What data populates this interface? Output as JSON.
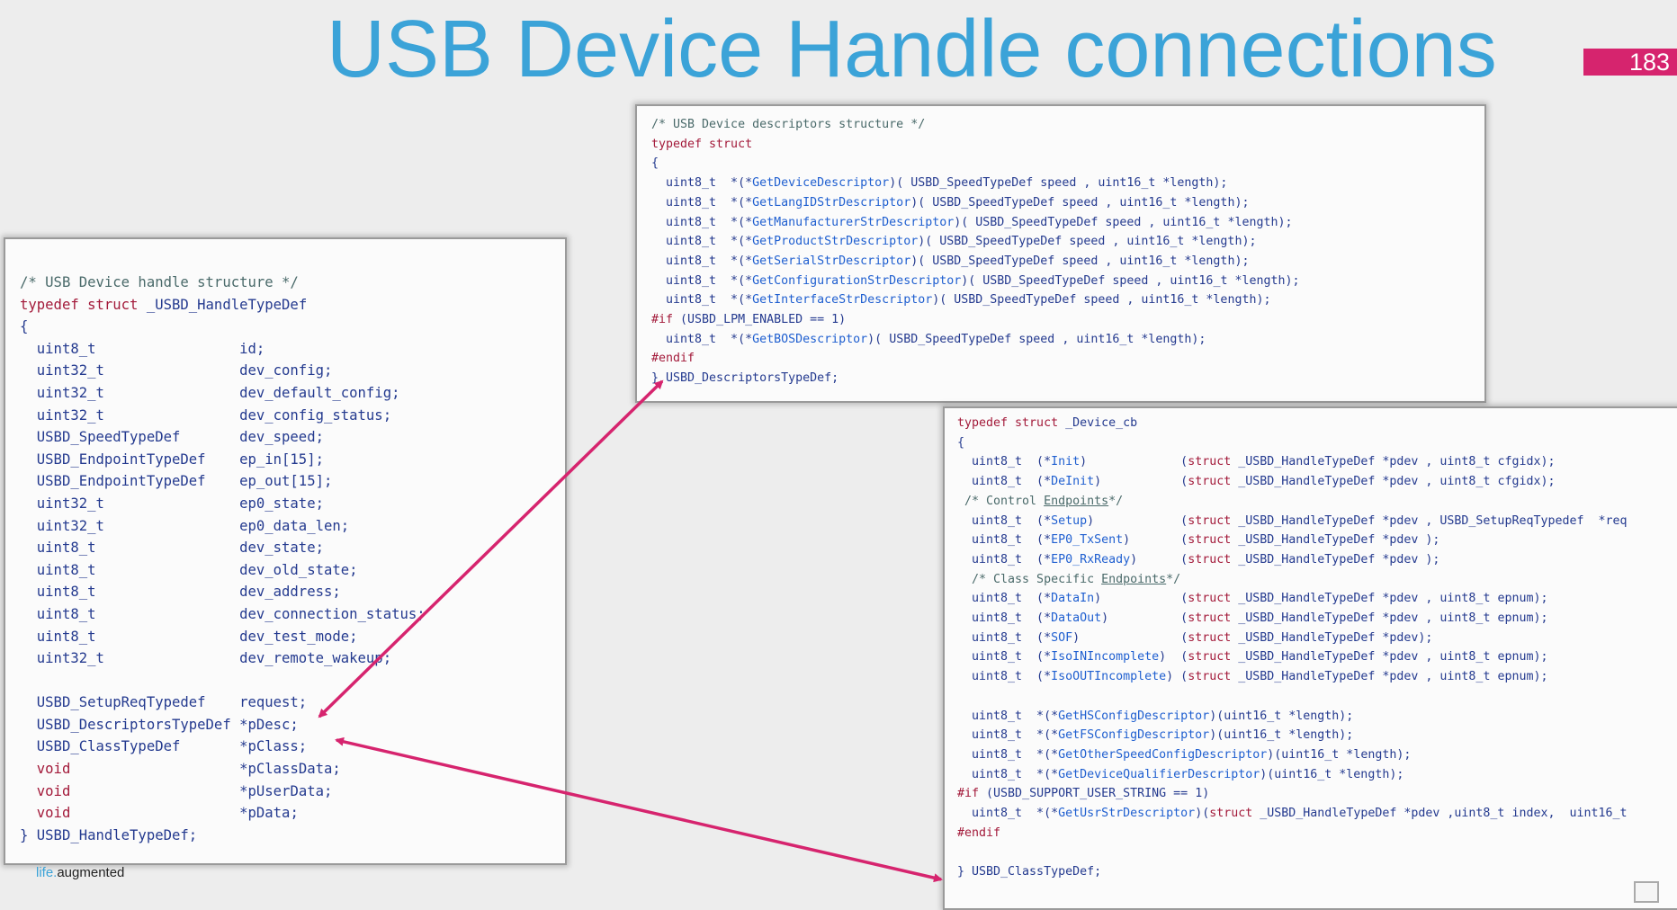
{
  "slide": {
    "title": "USB Device Handle connections",
    "page_number": "183",
    "footer": {
      "brand_life": "life.",
      "brand_rest": "augmented"
    }
  },
  "colors": {
    "title": "#3ba3d8",
    "badge": "#d6246e",
    "arrow": "#d6246e",
    "keyword": "#a31a3a",
    "function": "#1f5fd0",
    "code": "#243a8f",
    "comment": "#4a6a6a"
  },
  "handle_panel": {
    "lines": [
      [
        {
          "t": "/* USB Device handle structure */",
          "c": "cm"
        }
      ],
      [
        {
          "t": "typedef struct",
          "c": "kw"
        },
        {
          "t": " _USBD_HandleTypeDef"
        }
      ],
      [
        {
          "t": "{"
        }
      ],
      [
        {
          "t": "  uint8_t                 id;"
        }
      ],
      [
        {
          "t": "  uint32_t                dev_config;"
        }
      ],
      [
        {
          "t": "  uint32_t                dev_default_config;"
        }
      ],
      [
        {
          "t": "  uint32_t                dev_config_status;"
        }
      ],
      [
        {
          "t": "  USBD_SpeedTypeDef       dev_speed;"
        }
      ],
      [
        {
          "t": "  USBD_EndpointTypeDef    ep_in[15];"
        }
      ],
      [
        {
          "t": "  USBD_EndpointTypeDef    ep_out[15];"
        }
      ],
      [
        {
          "t": "  uint32_t                ep0_state;"
        }
      ],
      [
        {
          "t": "  uint32_t                ep0_data_len;"
        }
      ],
      [
        {
          "t": "  uint8_t                 dev_state;"
        }
      ],
      [
        {
          "t": "  uint8_t                 dev_old_state;"
        }
      ],
      [
        {
          "t": "  uint8_t                 dev_address;"
        }
      ],
      [
        {
          "t": "  uint8_t                 dev_connection_status;"
        }
      ],
      [
        {
          "t": "  uint8_t                 dev_test_mode;"
        }
      ],
      [
        {
          "t": "  uint32_t                dev_remote_wakeup;"
        }
      ],
      [
        {
          "t": " "
        }
      ],
      [
        {
          "t": "  USBD_SetupReqTypedef    request;"
        }
      ],
      [
        {
          "t": "  USBD_DescriptorsTypeDef *pDesc;"
        }
      ],
      [
        {
          "t": "  USBD_ClassTypeDef       *pClass;"
        }
      ],
      [
        {
          "t": "  void",
          "c": "kw"
        },
        {
          "t": "                    *pClassData;"
        }
      ],
      [
        {
          "t": "  void",
          "c": "kw"
        },
        {
          "t": "                    *pUserData;"
        }
      ],
      [
        {
          "t": "  void",
          "c": "kw"
        },
        {
          "t": "                    *pData;"
        }
      ],
      [
        {
          "t": "} USBD_HandleTypeDef;"
        }
      ]
    ]
  },
  "descriptors_panel": {
    "lines": [
      [
        {
          "t": "/* USB Device descriptors structure */",
          "c": "cm"
        }
      ],
      [
        {
          "t": "typedef struct",
          "c": "kw"
        }
      ],
      [
        {
          "t": "{"
        }
      ],
      [
        {
          "t": "  uint8_t  *(*"
        },
        {
          "t": "GetDeviceDescriptor",
          "c": "fn"
        },
        {
          "t": ")( USBD_SpeedTypeDef speed , uint16_t *length);"
        }
      ],
      [
        {
          "t": "  uint8_t  *(*"
        },
        {
          "t": "GetLangIDStrDescriptor",
          "c": "fn"
        },
        {
          "t": ")( USBD_SpeedTypeDef speed , uint16_t *length);"
        }
      ],
      [
        {
          "t": "  uint8_t  *(*"
        },
        {
          "t": "GetManufacturerStrDescriptor",
          "c": "fn"
        },
        {
          "t": ")( USBD_SpeedTypeDef speed , uint16_t *length);"
        }
      ],
      [
        {
          "t": "  uint8_t  *(*"
        },
        {
          "t": "GetProductStrDescriptor",
          "c": "fn"
        },
        {
          "t": ")( USBD_SpeedTypeDef speed , uint16_t *length);"
        }
      ],
      [
        {
          "t": "  uint8_t  *(*"
        },
        {
          "t": "GetSerialStrDescriptor",
          "c": "fn"
        },
        {
          "t": ")( USBD_SpeedTypeDef speed , uint16_t *length);"
        }
      ],
      [
        {
          "t": "  uint8_t  *(*"
        },
        {
          "t": "GetConfigurationStrDescriptor",
          "c": "fn"
        },
        {
          "t": ")( USBD_SpeedTypeDef speed , uint16_t *length);"
        }
      ],
      [
        {
          "t": "  uint8_t  *(*"
        },
        {
          "t": "GetInterfaceStrDescriptor",
          "c": "fn"
        },
        {
          "t": ")( USBD_SpeedTypeDef speed , uint16_t *length);"
        }
      ],
      [
        {
          "t": "#if",
          "c": "kw"
        },
        {
          "t": " (USBD_LPM_ENABLED == 1)"
        }
      ],
      [
        {
          "t": "  uint8_t  *(*"
        },
        {
          "t": "GetBOSDescriptor",
          "c": "fn"
        },
        {
          "t": ")( USBD_SpeedTypeDef speed , uint16_t *length);"
        }
      ],
      [
        {
          "t": "#endif",
          "c": "kw"
        }
      ],
      [
        {
          "t": "} USBD_DescriptorsTypeDef;"
        }
      ]
    ]
  },
  "class_panel": {
    "lines": [
      [
        {
          "t": "typedef struct",
          "c": "kw"
        },
        {
          "t": " _Device_cb"
        }
      ],
      [
        {
          "t": "{"
        }
      ],
      [
        {
          "t": "  uint8_t  (*"
        },
        {
          "t": "Init",
          "c": "fn"
        },
        {
          "t": ")             ("
        },
        {
          "t": "struct",
          "c": "kw"
        },
        {
          "t": " _USBD_HandleTypeDef *pdev , uint8_t cfgidx);"
        }
      ],
      [
        {
          "t": "  uint8_t  (*"
        },
        {
          "t": "DeInit",
          "c": "fn"
        },
        {
          "t": ")           ("
        },
        {
          "t": "struct",
          "c": "kw"
        },
        {
          "t": " _USBD_HandleTypeDef *pdev , uint8_t cfgidx);"
        }
      ],
      [
        {
          "t": " /* Control ",
          "c": "cm"
        },
        {
          "t": "Endpoints",
          "c": "cm ul"
        },
        {
          "t": "*/",
          "c": "cm"
        }
      ],
      [
        {
          "t": "  uint8_t  (*"
        },
        {
          "t": "Setup",
          "c": "fn"
        },
        {
          "t": ")            ("
        },
        {
          "t": "struct",
          "c": "kw"
        },
        {
          "t": " _USBD_HandleTypeDef *pdev , USBD_SetupReqTypedef  *req"
        }
      ],
      [
        {
          "t": "  uint8_t  (*"
        },
        {
          "t": "EP0_TxSent",
          "c": "fn"
        },
        {
          "t": ")       ("
        },
        {
          "t": "struct",
          "c": "kw"
        },
        {
          "t": " _USBD_HandleTypeDef *pdev );"
        }
      ],
      [
        {
          "t": "  uint8_t  (*"
        },
        {
          "t": "EP0_RxReady",
          "c": "fn"
        },
        {
          "t": ")      ("
        },
        {
          "t": "struct",
          "c": "kw"
        },
        {
          "t": " _USBD_HandleTypeDef *pdev );"
        }
      ],
      [
        {
          "t": "  /* Class Specific ",
          "c": "cm"
        },
        {
          "t": "Endpoints",
          "c": "cm ul"
        },
        {
          "t": "*/",
          "c": "cm"
        }
      ],
      [
        {
          "t": "  uint8_t  (*"
        },
        {
          "t": "DataIn",
          "c": "fn"
        },
        {
          "t": ")           ("
        },
        {
          "t": "struct",
          "c": "kw"
        },
        {
          "t": " _USBD_HandleTypeDef *pdev , uint8_t epnum);"
        }
      ],
      [
        {
          "t": "  uint8_t  (*"
        },
        {
          "t": "DataOut",
          "c": "fn"
        },
        {
          "t": ")          ("
        },
        {
          "t": "struct",
          "c": "kw"
        },
        {
          "t": " _USBD_HandleTypeDef *pdev , uint8_t epnum);"
        }
      ],
      [
        {
          "t": "  uint8_t  (*"
        },
        {
          "t": "SOF",
          "c": "fn"
        },
        {
          "t": ")              ("
        },
        {
          "t": "struct",
          "c": "kw"
        },
        {
          "t": " _USBD_HandleTypeDef *pdev);"
        }
      ],
      [
        {
          "t": "  uint8_t  (*"
        },
        {
          "t": "IsoINIncomplete",
          "c": "fn"
        },
        {
          "t": ")  ("
        },
        {
          "t": "struct",
          "c": "kw"
        },
        {
          "t": " _USBD_HandleTypeDef *pdev , uint8_t epnum);"
        }
      ],
      [
        {
          "t": "  uint8_t  (*"
        },
        {
          "t": "IsoOUTIncomplete",
          "c": "fn"
        },
        {
          "t": ") ("
        },
        {
          "t": "struct",
          "c": "kw"
        },
        {
          "t": " _USBD_HandleTypeDef *pdev , uint8_t epnum);"
        }
      ],
      [
        {
          "t": " "
        }
      ],
      [
        {
          "t": "  uint8_t  *(*"
        },
        {
          "t": "GetHSConfigDescriptor",
          "c": "fn"
        },
        {
          "t": ")(uint16_t *length);"
        }
      ],
      [
        {
          "t": "  uint8_t  *(*"
        },
        {
          "t": "GetFSConfigDescriptor",
          "c": "fn"
        },
        {
          "t": ")(uint16_t *length);"
        }
      ],
      [
        {
          "t": "  uint8_t  *(*"
        },
        {
          "t": "GetOtherSpeedConfigDescriptor",
          "c": "fn"
        },
        {
          "t": ")(uint16_t *length);"
        }
      ],
      [
        {
          "t": "  uint8_t  *(*"
        },
        {
          "t": "GetDeviceQualifierDescriptor",
          "c": "fn"
        },
        {
          "t": ")(uint16_t *length);"
        }
      ],
      [
        {
          "t": "#if",
          "c": "kw"
        },
        {
          "t": " (USBD_SUPPORT_USER_STRING == 1)"
        }
      ],
      [
        {
          "t": "  uint8_t  *(*"
        },
        {
          "t": "GetUsrStrDescriptor",
          "c": "fn"
        },
        {
          "t": ")("
        },
        {
          "t": "struct",
          "c": "kw"
        },
        {
          "t": " _USBD_HandleTypeDef *pdev ,uint8_t index,  uint16_t"
        }
      ],
      [
        {
          "t": "#endif",
          "c": "kw"
        }
      ],
      [
        {
          "t": " "
        }
      ],
      [
        {
          "t": "} USBD_ClassTypeDef;"
        }
      ]
    ]
  }
}
